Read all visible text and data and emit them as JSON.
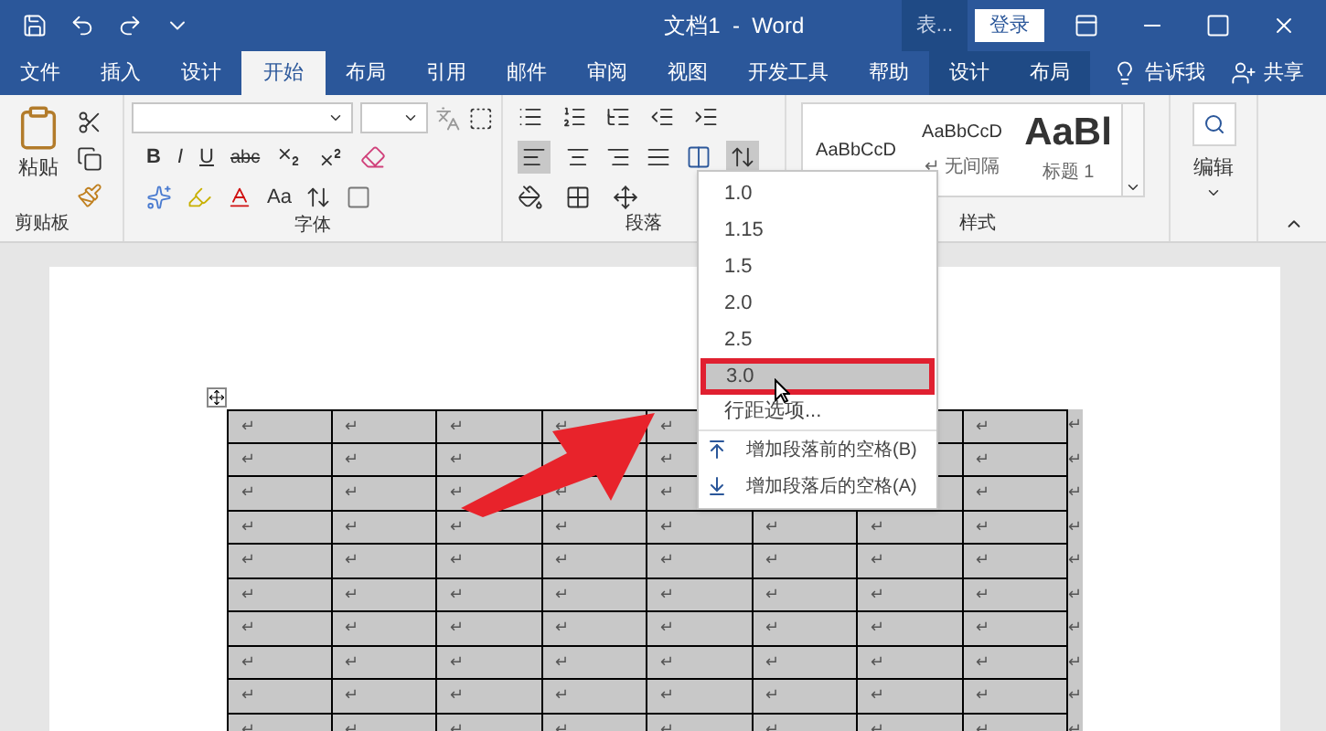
{
  "title_bar": {
    "title": "文档1  -  Word",
    "context_label": "表...",
    "login": "登录"
  },
  "tabs": [
    {
      "label": "文件",
      "selected": false,
      "kind": "normal"
    },
    {
      "label": "插入",
      "selected": false,
      "kind": "normal"
    },
    {
      "label": "设计",
      "selected": false,
      "kind": "normal"
    },
    {
      "label": "开始",
      "selected": true,
      "kind": "normal"
    },
    {
      "label": "布局",
      "selected": false,
      "kind": "normal"
    },
    {
      "label": "引用",
      "selected": false,
      "kind": "normal"
    },
    {
      "label": "邮件",
      "selected": false,
      "kind": "normal"
    },
    {
      "label": "审阅",
      "selected": false,
      "kind": "normal"
    },
    {
      "label": "视图",
      "selected": false,
      "kind": "normal"
    },
    {
      "label": "开发工具",
      "selected": false,
      "kind": "normal"
    },
    {
      "label": "帮助",
      "selected": false,
      "kind": "normal"
    },
    {
      "label": "设计",
      "selected": false,
      "kind": "context"
    },
    {
      "label": "布局",
      "selected": false,
      "kind": "context"
    }
  ],
  "tell_me": "告诉我",
  "share": "共享",
  "ribbon": {
    "clipboard": {
      "paste": "粘贴",
      "label": "剪贴板"
    },
    "font": {
      "label": "字体",
      "bold": "B",
      "italic": "I",
      "underline": "U",
      "strike": "abc",
      "case": "Aa"
    },
    "paragraph": {
      "label": "段落"
    },
    "styles": {
      "label": "样式",
      "items": [
        {
          "sample": "AaBbCcD",
          "kind": "small"
        },
        {
          "sample": "AaBbCcD",
          "name": "↵ 无间隔",
          "kind": "small"
        },
        {
          "sample": "AaBl",
          "name": "标题 1",
          "kind": "large"
        }
      ]
    },
    "editing": {
      "label": "编辑"
    }
  },
  "line_spacing_menu": [
    {
      "kind": "value",
      "label": "1.0",
      "selected": false
    },
    {
      "kind": "value",
      "label": "1.15",
      "selected": false
    },
    {
      "kind": "value",
      "label": "1.5",
      "selected": false
    },
    {
      "kind": "value",
      "label": "2.0",
      "selected": false
    },
    {
      "kind": "value",
      "label": "2.5",
      "selected": false
    },
    {
      "kind": "value",
      "label": "3.0",
      "selected": true
    },
    {
      "kind": "option",
      "label": "行距选项..."
    },
    {
      "kind": "before",
      "label": "增加段落前的空格(B)"
    },
    {
      "kind": "after",
      "label": "增加段落后的空格(A)"
    }
  ],
  "table": {
    "rows": [
      [
        "↵",
        "↵",
        "↵",
        "↵",
        "↵",
        false,
        null,
        "↵",
        "↵"
      ],
      [
        "↵",
        "↵",
        "↵",
        null,
        "↵",
        false,
        null,
        "↵",
        "↵"
      ],
      [
        "↵",
        "↵",
        "↵",
        "↵",
        "↵",
        false,
        null,
        "↵",
        "↵"
      ],
      [
        "↵",
        "↵",
        "↵",
        "↵",
        "↵",
        "↵",
        "↵",
        "↵",
        "↵"
      ],
      [
        "↵",
        "↵",
        "↵",
        "↵",
        "↵",
        "↵",
        "↵",
        "↵",
        "↵"
      ],
      [
        "↵",
        "↵",
        "↵",
        "↵",
        "↵",
        "↵",
        "↵",
        "↵",
        "↵"
      ],
      [
        "↵",
        "↵",
        "↵",
        "↵",
        "↵",
        "↵",
        "↵",
        "↵",
        "↵"
      ],
      [
        "↵",
        "↵",
        "↵",
        "↵",
        "↵",
        "↵",
        "↵",
        "↵",
        "↵"
      ],
      [
        "↵",
        "↵",
        "↵",
        "↵",
        "↵",
        "↵",
        "↵",
        "↵",
        "↵"
      ],
      [
        "↵",
        "↵",
        "↵",
        "↵",
        "↵",
        "↵",
        "↵",
        "↵",
        "↵"
      ]
    ]
  }
}
